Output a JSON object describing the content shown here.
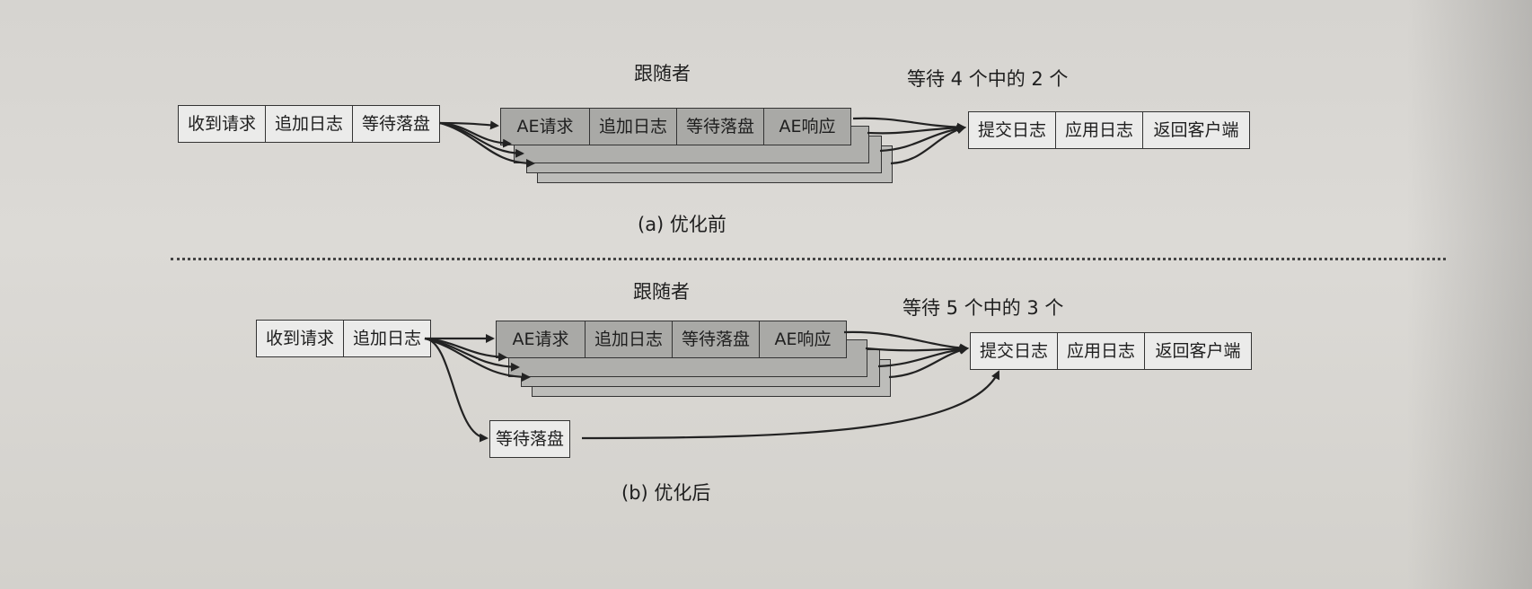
{
  "section_a": {
    "follower_label": "跟随者",
    "wait_label": "等待 4 个中的 2 个",
    "leader_steps": [
      "收到请求",
      "追加日志",
      "等待落盘"
    ],
    "follower_steps": [
      "AE请求",
      "追加日志",
      "等待落盘",
      "AE响应"
    ],
    "commit_steps": [
      "提交日志",
      "应用日志",
      "返回客户端"
    ],
    "caption": "(a) 优化前"
  },
  "section_b": {
    "follower_label": "跟随者",
    "wait_label": "等待 5 个中的 3 个",
    "leader_steps": [
      "收到请求",
      "追加日志"
    ],
    "follower_steps": [
      "AE请求",
      "追加日志",
      "等待落盘",
      "AE响应"
    ],
    "commit_steps": [
      "提交日志",
      "应用日志",
      "返回客户端"
    ],
    "parallel_step": "等待落盘",
    "caption": "(b) 优化后"
  }
}
